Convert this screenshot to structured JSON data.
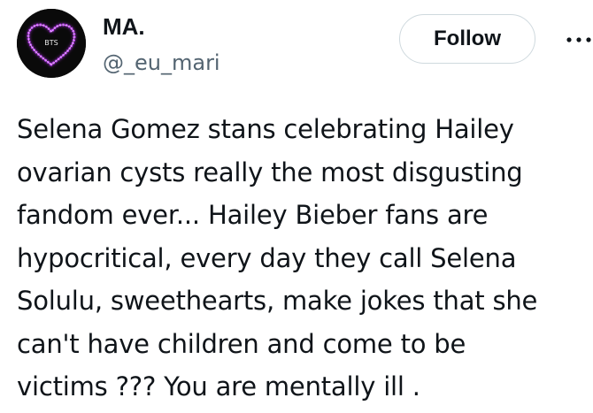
{
  "author": {
    "display_name": "MA.",
    "handle": "@_eu_mari",
    "avatar_text": "BTS"
  },
  "actions": {
    "follow_label": "Follow",
    "more_icon": "more-horizontal-icon"
  },
  "tweet": {
    "lines": [
      "Selena Gomez stans celebrating Hailey",
      "ovarian cysts really the most disgusting",
      "fandom ever... Hailey Bieber fans are",
      "hypocritical, every day they call Selena",
      "Solulu, sweethearts, make jokes that she",
      "can't have children and come to be",
      "victims ??? You are mentally ill ."
    ]
  },
  "colors": {
    "text_primary": "#0f1419",
    "text_secondary": "#536471",
    "border": "#cfd9de",
    "avatar_glow": "#c23bff"
  }
}
